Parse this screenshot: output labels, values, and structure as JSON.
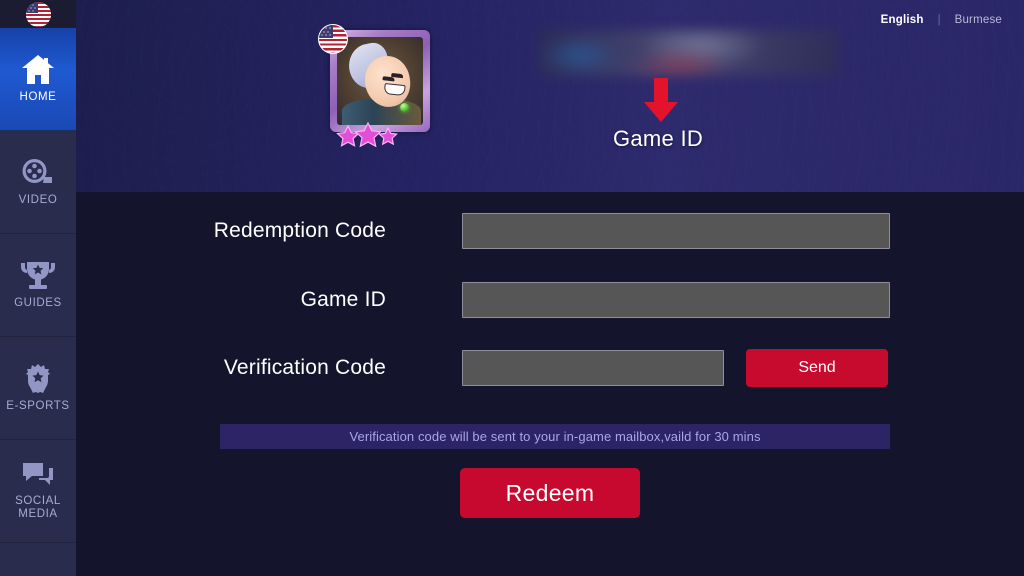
{
  "sidebar": {
    "flag_icon": "us-flag-icon",
    "items": [
      {
        "id": "home",
        "label": "HOME",
        "icon": "home-icon",
        "active": true
      },
      {
        "id": "video",
        "label": "VIDEO",
        "icon": "film-reel-icon",
        "active": false
      },
      {
        "id": "guides",
        "label": "GUIDES",
        "icon": "trophy-icon",
        "active": false
      },
      {
        "id": "esports",
        "label": "E-SPORTS",
        "icon": "shield-star-icon",
        "active": false
      },
      {
        "id": "social_media",
        "label": "SOCIAL\nMEDIA",
        "icon": "chat-bubbles-icon",
        "active": false
      }
    ]
  },
  "header": {
    "languages": {
      "primary": "English",
      "separator": "|",
      "secondary": "Burmese",
      "active": "English"
    },
    "avatar": {
      "name": "player-avatar",
      "flag_badge": "us-flag-icon",
      "stars": 3
    },
    "redacted_field": {
      "name": "blurred-account-name",
      "value": ""
    },
    "arrow": "red-down-arrow-icon",
    "caption": "Game ID"
  },
  "form": {
    "rows": [
      {
        "label": "Redemption Code",
        "value": "",
        "placeholder": ""
      },
      {
        "label": "Game ID",
        "value": "",
        "placeholder": ""
      },
      {
        "label": "Verification Code",
        "value": "",
        "placeholder": ""
      }
    ],
    "send_label": "Send",
    "notice": "Verification code will be sent to your in-game mailbox,vaild for 30 mins",
    "redeem_label": "Redeem"
  },
  "colors": {
    "accent_red": "#c8092f",
    "send_red": "#c60b2e",
    "nav_active_blue": "#1f59d2",
    "header_indigo": "#2a2768",
    "page_navy": "#14142c",
    "notice_purple": "#2d2466",
    "input_grey": "#565656",
    "notice_text": "#a9a6e8"
  }
}
